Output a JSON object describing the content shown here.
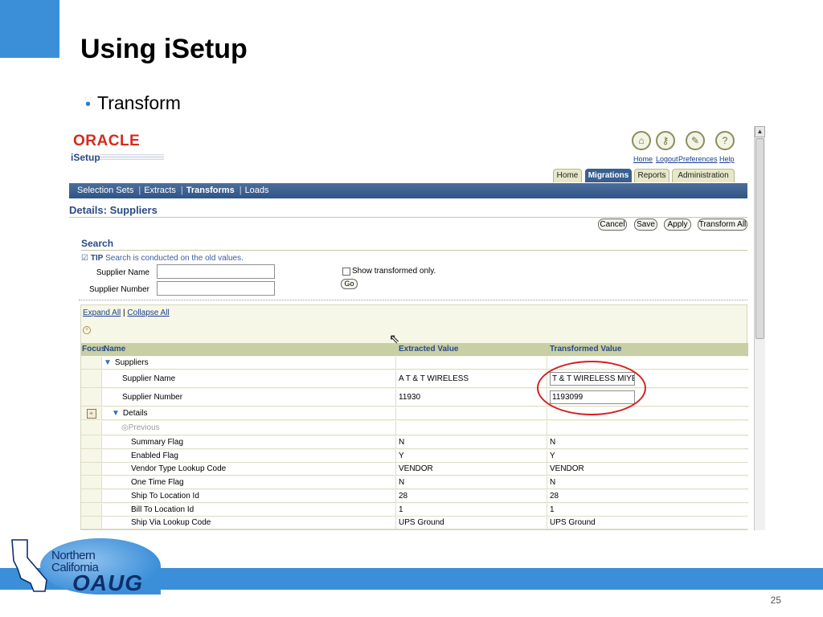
{
  "slide": {
    "title": "Using iSetup",
    "bullet": "Transform",
    "page_number": "25",
    "footer_logo": {
      "line1": "Northern",
      "line2": "California",
      "org": "OAUG"
    }
  },
  "app": {
    "brand": "ORACLE",
    "product": "iSetup",
    "global_links": [
      "Home",
      "Logout",
      "Preferences",
      "Help"
    ],
    "tabs": [
      {
        "label": "Home",
        "active": false
      },
      {
        "label": "Migrations",
        "active": true
      },
      {
        "label": "Reports",
        "active": false
      },
      {
        "label": "Administration",
        "active": false
      }
    ],
    "subnav": [
      "Selection Sets",
      "Extracts",
      "Transforms",
      "Loads"
    ],
    "subnav_current": "Transforms",
    "page_title": "Details: Suppliers",
    "buttons": {
      "cancel": "Cancel",
      "save": "Save",
      "apply": "Apply",
      "transform_all": "Transform All"
    },
    "search": {
      "title": "Search",
      "tip_label": "TIP",
      "tip_text": "Search is conducted on the old values.",
      "supplier_name_label": "Supplier Name",
      "supplier_number_label": "Supplier Number",
      "supplier_name_value": "",
      "supplier_number_value": "",
      "show_transformed_label": "Show transformed only.",
      "show_transformed_checked": false,
      "go_label": "Go"
    },
    "grid": {
      "expand_all": "Expand All",
      "collapse_all": "Collapse All",
      "columns": {
        "focus": "Focus",
        "name": "Name",
        "extracted": "Extracted Value",
        "transformed": "Transformed Value"
      },
      "suppliers_node": "Suppliers",
      "details_node": "Details",
      "previous_label": "Previous",
      "editable_rows": [
        {
          "name": "Supplier Name",
          "extracted": "A T & T WIRELESS",
          "transformed": "T & T WIRELESS MIYER"
        },
        {
          "name": "Supplier Number",
          "extracted": "11930",
          "transformed": "1193099"
        }
      ],
      "detail_rows": [
        {
          "name": "Summary Flag",
          "extracted": "N",
          "transformed": "N"
        },
        {
          "name": "Enabled Flag",
          "extracted": "Y",
          "transformed": "Y"
        },
        {
          "name": "Vendor Type Lookup Code",
          "extracted": "VENDOR",
          "transformed": "VENDOR"
        },
        {
          "name": "One Time Flag",
          "extracted": "N",
          "transformed": "N"
        },
        {
          "name": "Ship To Location Id",
          "extracted": "28",
          "transformed": "28"
        },
        {
          "name": "Bill To Location Id",
          "extracted": "1",
          "transformed": "1"
        },
        {
          "name": "Ship Via Lookup Code",
          "extracted": "UPS Ground",
          "transformed": "UPS Ground"
        }
      ]
    }
  },
  "colors": {
    "accent": "#3b8fd9",
    "oracle_red": "#d52b1e",
    "nav_blue": "#2f5587",
    "annotation_red": "#d42020"
  }
}
